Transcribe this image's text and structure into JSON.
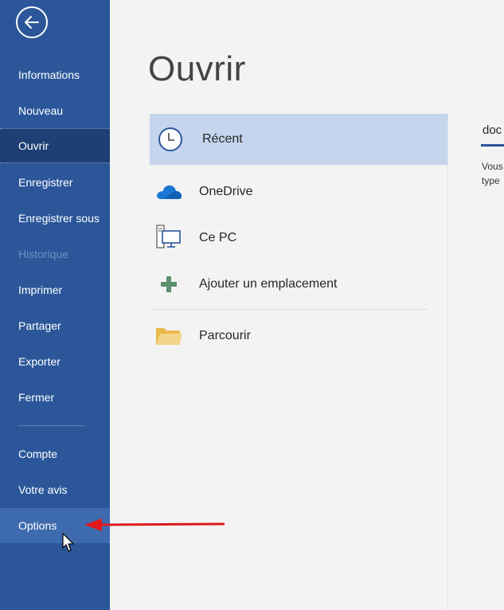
{
  "sidebar": {
    "items": [
      {
        "label": "Informations"
      },
      {
        "label": "Nouveau"
      },
      {
        "label": "Ouvrir"
      },
      {
        "label": "Enregistrer"
      },
      {
        "label": "Enregistrer sous"
      },
      {
        "label": "Historique"
      },
      {
        "label": "Imprimer"
      },
      {
        "label": "Partager"
      },
      {
        "label": "Exporter"
      },
      {
        "label": "Fermer"
      },
      {
        "label": "Compte"
      },
      {
        "label": "Votre avis"
      },
      {
        "label": "Options"
      }
    ],
    "selected": "Ouvrir",
    "disabled": "Historique"
  },
  "main": {
    "title": "Ouvrir",
    "locations": [
      {
        "label": "Récent",
        "icon": "clock-icon"
      },
      {
        "label": "OneDrive",
        "icon": "cloud-icon"
      },
      {
        "label": "Ce PC",
        "icon": "computer-icon"
      },
      {
        "label": "Ajouter un emplacement",
        "icon": "plus-icon"
      },
      {
        "label": "Parcourir",
        "icon": "folder-icon"
      }
    ]
  },
  "right_panel": {
    "heading": "doc",
    "line1": "Vous",
    "line2": "type"
  },
  "colors": {
    "sidebar": "#2b579a",
    "selected_nav": "#1e3f73",
    "selected_location": "#c5d5ee",
    "annotation_arrow": "#e0191f"
  }
}
